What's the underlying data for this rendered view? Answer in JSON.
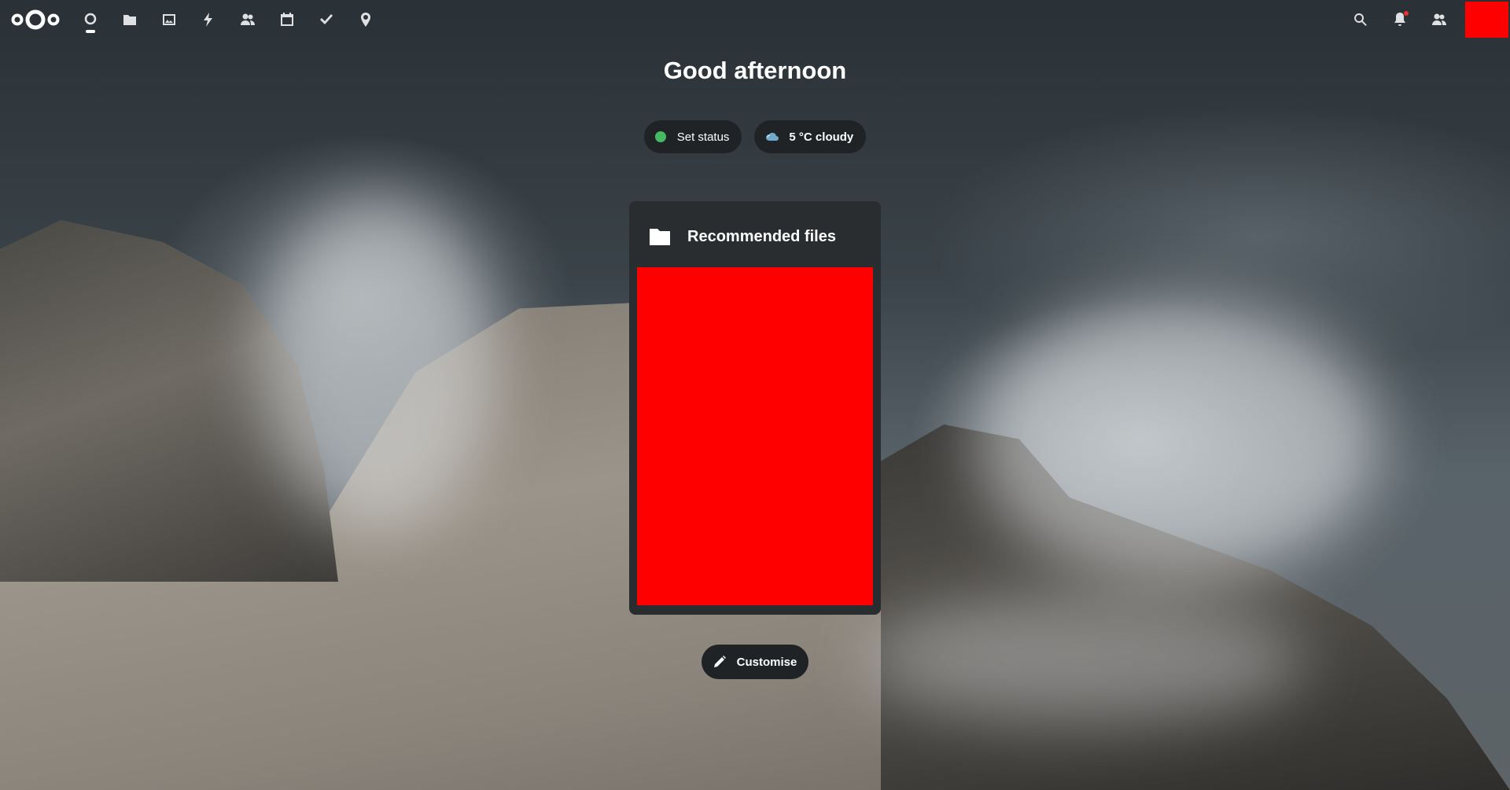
{
  "header": {
    "logo_icon": "nextcloud-logo",
    "nav": [
      {
        "name": "dashboard",
        "icon": "dashboard-icon",
        "active": true
      },
      {
        "name": "files",
        "icon": "folder-icon"
      },
      {
        "name": "photos",
        "icon": "image-icon"
      },
      {
        "name": "activity",
        "icon": "lightning-icon"
      },
      {
        "name": "contacts",
        "icon": "contacts-icon"
      },
      {
        "name": "calendar",
        "icon": "calendar-icon"
      },
      {
        "name": "tasks",
        "icon": "checkmark-icon"
      },
      {
        "name": "maps",
        "icon": "location-icon"
      }
    ],
    "right": [
      "search-icon",
      "notifications-icon",
      "contacts-menu-icon"
    ],
    "notification_dot_color": "#e9322d",
    "avatar_color": "#ff0000"
  },
  "greeting": "Good afternoon",
  "status": {
    "label": "Set status",
    "dot_color": "#46ba61"
  },
  "weather": {
    "label": "5 °C cloudy",
    "icon": "cloudy-icon"
  },
  "panel": {
    "title": "Recommended files",
    "icon": "folder-icon",
    "content_color": "#ff0000"
  },
  "customise_label": "Customise"
}
